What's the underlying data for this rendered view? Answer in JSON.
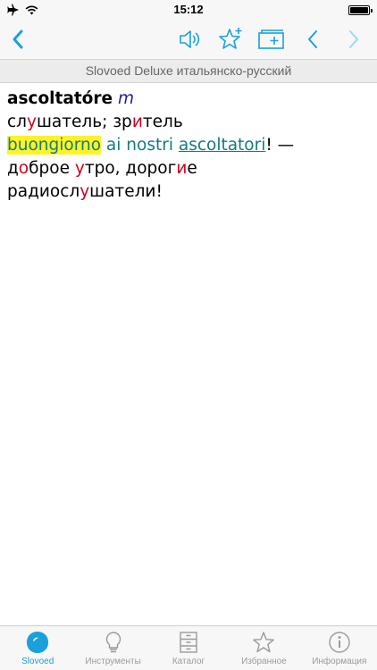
{
  "status": {
    "time": "15:12"
  },
  "toolbar": {
    "back_icon": "chevron-left-icon",
    "sound_icon": "speaker-icon",
    "favorite_icon": "star-plus-icon",
    "add_card_icon": "card-add-icon",
    "prev_icon": "chevron-left-icon",
    "next_icon": "chevron-right-icon"
  },
  "title": "Slovoed Deluxe итальянско-русский",
  "entry": {
    "headword": "ascoltatóre",
    "pos": "m",
    "translation": [
      {
        "t": "сл"
      },
      {
        "t": "у",
        "s": true
      },
      {
        "t": "шатель; зр"
      },
      {
        "t": "и",
        "s": true
      },
      {
        "t": "тель"
      }
    ],
    "example_it": {
      "highlight": "buongiorno",
      "middle": " ai nostri ",
      "link": "ascoltatori",
      "end": "! —"
    },
    "example_ru": [
      {
        "t": "д"
      },
      {
        "t": "о",
        "s": true
      },
      {
        "t": "брое "
      },
      {
        "t": "у",
        "s": true
      },
      {
        "t": "тро, дорог"
      },
      {
        "t": "и",
        "s": true
      },
      {
        "t": "е"
      }
    ],
    "example_ru2": [
      {
        "t": "радиосл"
      },
      {
        "t": "у",
        "s": true
      },
      {
        "t": "шатели!"
      }
    ]
  },
  "tabs": [
    {
      "label": "Slovoed",
      "icon": "slovoed-logo-icon",
      "active": true
    },
    {
      "label": "Инструменты",
      "icon": "lightbulb-icon"
    },
    {
      "label": "Каталог",
      "icon": "cabinet-icon"
    },
    {
      "label": "Избранное",
      "icon": "star-icon"
    },
    {
      "label": "Информация",
      "icon": "info-icon"
    }
  ],
  "colors": {
    "accent": "#1aa1dc",
    "stress": "#d0021b",
    "example": "#0f7d7d",
    "highlight": "#fff227",
    "pos": "#1f1aa6"
  }
}
